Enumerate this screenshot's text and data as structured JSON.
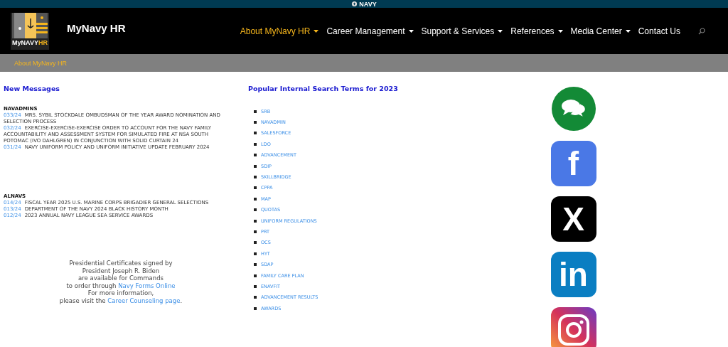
{
  "top_bar": {
    "label": "NAVY"
  },
  "header": {
    "logo_text": "MyNAVY",
    "logo_accent": "HR",
    "site_title": "MyNavy HR"
  },
  "nav": [
    {
      "label": "About MyNavy HR",
      "selected": true,
      "dropdown": true
    },
    {
      "label": "Career Management",
      "selected": false,
      "dropdown": true
    },
    {
      "label": "Support & Services",
      "selected": false,
      "dropdown": true
    },
    {
      "label": "References",
      "selected": false,
      "dropdown": true
    },
    {
      "label": "Media Center",
      "selected": false,
      "dropdown": true
    },
    {
      "label": "Contact Us",
      "selected": false,
      "dropdown": false
    }
  ],
  "breadcrumb": "About MyNavy HR",
  "messages": {
    "title": "New Messages",
    "groups": [
      {
        "heading": "NAVADMINS",
        "items": [
          {
            "number": "033/24",
            "text": "MRS. SYBIL STOCKDALE OMBUDSMAN OF THE YEAR AWARD NOMINATION AND SELECTION PROCESS"
          },
          {
            "number": "032/24",
            "text": "EXERCISE-EXERCISE-EXERCISE ORDER TO ACCOUNT FOR THE NAVY FAMILY ACCOUNTABILITY AND ASSESSMENT SYSTEM FOR SIMULATED FIRE AT NSA SOUTH POTOMAC (IVO DAHLGREN) IN CONJUNCTION WITH SOLID CURTAIN 24"
          },
          {
            "number": "031/24",
            "text": "NAVY UNIFORM POLICY AND UNIFORM INITIATIVE UPDATE FEBRUARY 2024"
          }
        ]
      },
      {
        "heading": "ALNAVS",
        "items": [
          {
            "number": "014/24",
            "text": "FISCAL YEAR 2025 U.S. MARINE CORPS BRIGADIER GENERAL SELECTIONS"
          },
          {
            "number": "013/24",
            "text": "DEPARTMENT OF THE NAVY 2024 BLACK HISTORY MONTH"
          },
          {
            "number": "012/24",
            "text": "2023 ANNUAL NAVY LEAGUE SEA SERVICE AWARDS"
          }
        ]
      }
    ]
  },
  "certificates": {
    "lines": [
      "Presidential Certificates signed by",
      "President Joseph R. Biden",
      "are available for Commands"
    ],
    "order_text": "to order through",
    "order_link": "Navy Forms Online",
    "more_text": "For more information,",
    "visit_text": "please visit the",
    "visit_link": "Career Counseling page",
    "visit_end": "."
  },
  "search_terms": {
    "title": "Popular Internal Search Terms for 2023",
    "items": [
      "SRB",
      "NAVADMIN",
      "SALESFORCE",
      "LDO",
      "ADVANCEMENT",
      "SDIP",
      "SKILLBRIDGE",
      "CPPA",
      "MAP",
      "QUOTAS",
      "UNIFORM REGULATIONS",
      "PRT",
      "OCS",
      "HYT",
      "SDAP",
      "FAMILY CARE PLAN",
      "ENAVFIT",
      "ADVANCEMENT RESULTS",
      "AWARDS"
    ]
  },
  "social": [
    {
      "kind": "chat"
    },
    {
      "kind": "glyph",
      "glyph": "f",
      "color": "#4a78e6"
    },
    {
      "kind": "glyph",
      "glyph": "X",
      "color": "#000000"
    },
    {
      "kind": "glyph",
      "glyph": "in",
      "color": "#0a7ec2"
    },
    {
      "kind": "camera"
    }
  ]
}
